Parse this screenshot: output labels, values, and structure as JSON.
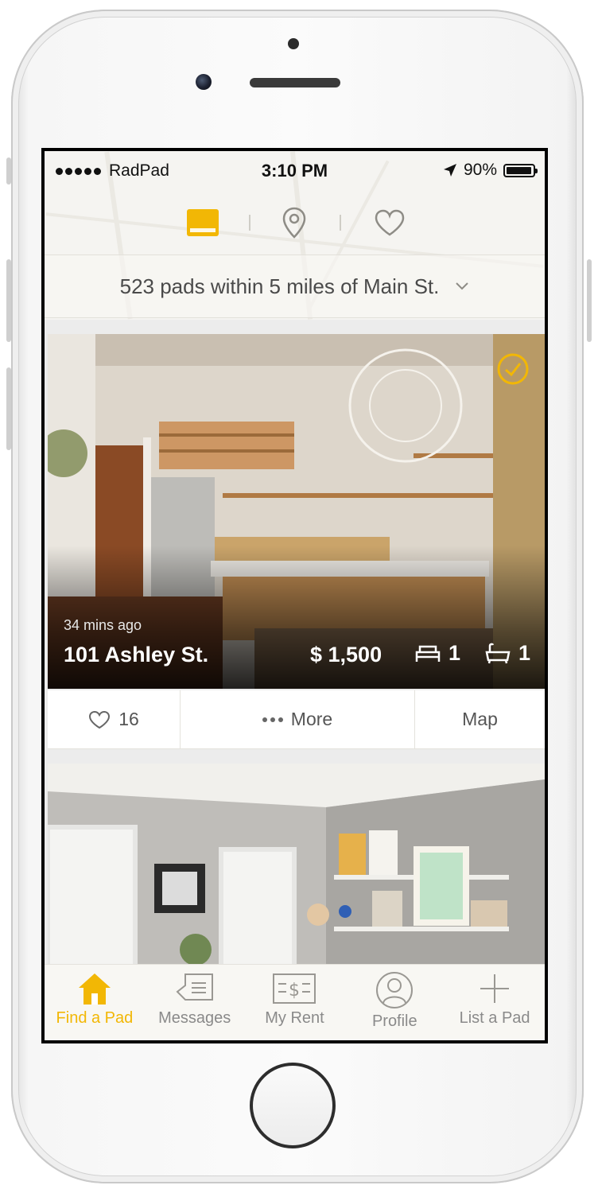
{
  "status_bar": {
    "carrier": "RadPad",
    "time": "3:10 PM",
    "battery": "90%"
  },
  "view_tabs": [
    {
      "icon": "card-view-icon",
      "active": true
    },
    {
      "icon": "map-pin-icon",
      "active": false
    },
    {
      "icon": "heart-icon",
      "active": false
    }
  ],
  "filter": {
    "summary": "523 pads within 5 miles of Main St."
  },
  "listing": {
    "posted": "34 mins ago",
    "address": "101 Ashley St.",
    "price": "$ 1,500",
    "beds": "1",
    "baths": "1",
    "verified_icon": "check-circle-icon"
  },
  "actions": {
    "likes": "16",
    "more_label": "More",
    "map_label": "Map"
  },
  "tabbar": {
    "items": [
      {
        "label": "Find a Pad",
        "icon": "house-icon",
        "active": true
      },
      {
        "label": "Messages",
        "icon": "message-bubble-icon",
        "active": false
      },
      {
        "label": "My Rent",
        "icon": "dollar-bill-icon",
        "active": false
      },
      {
        "label": "Profile",
        "icon": "person-icon",
        "active": false
      },
      {
        "label": "List a Pad",
        "icon": "plus-icon",
        "active": false
      }
    ]
  },
  "colors": {
    "accent": "#f2b705",
    "text_muted": "#8a8a8a"
  }
}
